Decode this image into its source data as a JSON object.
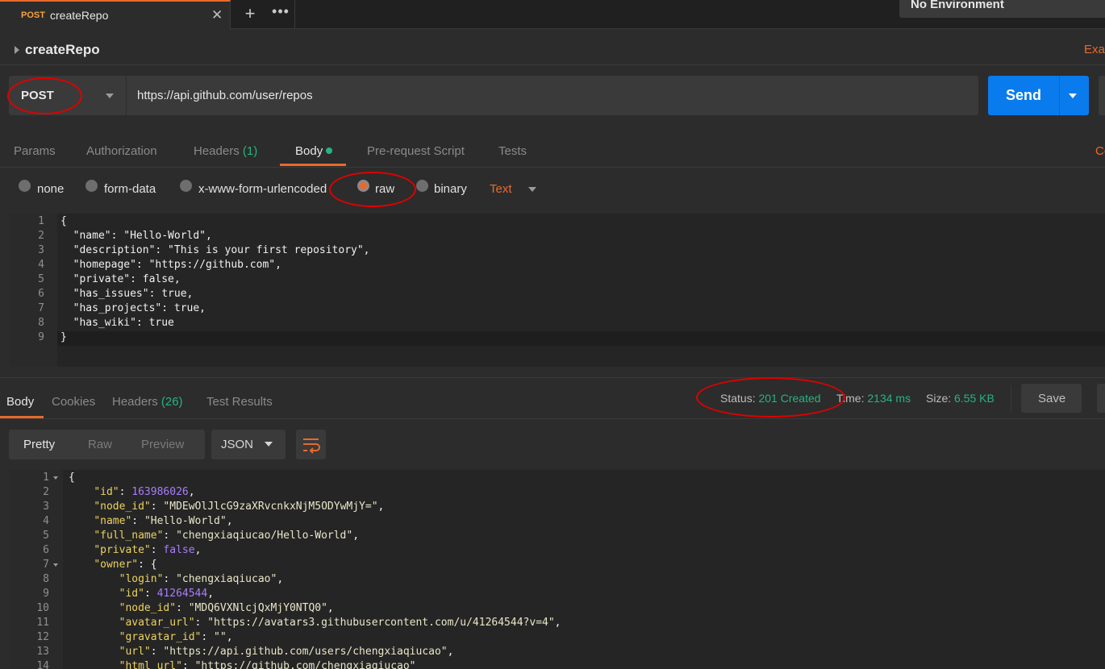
{
  "tabbar": {
    "active_tab": {
      "method": "POST",
      "name": "createRepo",
      "close": "✕"
    },
    "add_label": "+",
    "more_label": "•••",
    "environment": "No Environment"
  },
  "request": {
    "name": "createRepo",
    "examples_label": "Exa",
    "method": "POST",
    "url": "https://api.github.com/user/repos",
    "send_label": "Send"
  },
  "request_tabs": {
    "params": "Params",
    "authorization": "Authorization",
    "headers": "Headers",
    "headers_count": "(1)",
    "body": "Body",
    "prerequest": "Pre-request Script",
    "tests": "Tests",
    "cookies_right": "Co"
  },
  "body_types": {
    "none": "none",
    "form_data": "form-data",
    "urlencoded": "x-www-form-urlencoded",
    "raw": "raw",
    "binary": "binary",
    "text_type": "Text"
  },
  "request_body": {
    "line_numbers": [
      "1",
      "2",
      "3",
      "4",
      "5",
      "6",
      "7",
      "8",
      "9"
    ],
    "lines": [
      "{",
      "  \"name\": \"Hello-World\",",
      "  \"description\": \"This is your first repository\",",
      "  \"homepage\": \"https://github.com\",",
      "  \"private\": false,",
      "  \"has_issues\": true,",
      "  \"has_projects\": true,",
      "  \"has_wiki\": true",
      "}"
    ]
  },
  "response": {
    "tabs": {
      "body": "Body",
      "cookies": "Cookies",
      "headers": "Headers",
      "headers_count": "(26)",
      "test_results": "Test Results"
    },
    "status_label": "Status:",
    "status_value": "201 Created",
    "time_label": "Time:",
    "time_value": "2134 ms",
    "size_label": "Size:",
    "size_value": "6.55 KB",
    "save_label": "Save",
    "view_modes": {
      "pretty": "Pretty",
      "raw": "Raw",
      "preview": "Preview"
    },
    "format": "JSON",
    "line_numbers": [
      "1",
      "2",
      "3",
      "4",
      "5",
      "6",
      "7",
      "8",
      "9",
      "10",
      "11",
      "12",
      "13",
      "14"
    ],
    "lines": [
      [
        [
          "jp",
          "{"
        ]
      ],
      [
        [
          "jp",
          "    "
        ],
        [
          "jk",
          "\"id\""
        ],
        [
          "jp",
          ": "
        ],
        [
          "jn",
          "163986026"
        ],
        [
          "jp",
          ","
        ]
      ],
      [
        [
          "jp",
          "    "
        ],
        [
          "jk",
          "\"node_id\""
        ],
        [
          "jp",
          ": "
        ],
        [
          "js",
          "\"MDEwOlJlcG9zaXRvcnkxNjM5ODYwMjY=\""
        ],
        [
          "jp",
          ","
        ]
      ],
      [
        [
          "jp",
          "    "
        ],
        [
          "jk",
          "\"name\""
        ],
        [
          "jp",
          ": "
        ],
        [
          "js",
          "\"Hello-World\""
        ],
        [
          "jp",
          ","
        ]
      ],
      [
        [
          "jp",
          "    "
        ],
        [
          "jk",
          "\"full_name\""
        ],
        [
          "jp",
          ": "
        ],
        [
          "js",
          "\"chengxiaqiucao/Hello-World\""
        ],
        [
          "jp",
          ","
        ]
      ],
      [
        [
          "jp",
          "    "
        ],
        [
          "jk",
          "\"private\""
        ],
        [
          "jp",
          ": "
        ],
        [
          "jb",
          "false"
        ],
        [
          "jp",
          ","
        ]
      ],
      [
        [
          "jp",
          "    "
        ],
        [
          "jk",
          "\"owner\""
        ],
        [
          "jp",
          ": {"
        ]
      ],
      [
        [
          "jp",
          "        "
        ],
        [
          "jk",
          "\"login\""
        ],
        [
          "jp",
          ": "
        ],
        [
          "js",
          "\"chengxiaqiucao\""
        ],
        [
          "jp",
          ","
        ]
      ],
      [
        [
          "jp",
          "        "
        ],
        [
          "jk",
          "\"id\""
        ],
        [
          "jp",
          ": "
        ],
        [
          "jn",
          "41264544"
        ],
        [
          "jp",
          ","
        ]
      ],
      [
        [
          "jp",
          "        "
        ],
        [
          "jk",
          "\"node_id\""
        ],
        [
          "jp",
          ": "
        ],
        [
          "js",
          "\"MDQ6VXNlcjQxMjY0NTQ0\""
        ],
        [
          "jp",
          ","
        ]
      ],
      [
        [
          "jp",
          "        "
        ],
        [
          "jk",
          "\"avatar_url\""
        ],
        [
          "jp",
          ": "
        ],
        [
          "js",
          "\"https://avatars3.githubusercontent.com/u/41264544?v=4\""
        ],
        [
          "jp",
          ","
        ]
      ],
      [
        [
          "jp",
          "        "
        ],
        [
          "jk",
          "\"gravatar_id\""
        ],
        [
          "jp",
          ": "
        ],
        [
          "js",
          "\"\""
        ],
        [
          "jp",
          ","
        ]
      ],
      [
        [
          "jp",
          "        "
        ],
        [
          "jk",
          "\"url\""
        ],
        [
          "jp",
          ": "
        ],
        [
          "js",
          "\"https://api.github.com/users/chengxiaqiucao\""
        ],
        [
          "jp",
          ","
        ]
      ],
      [
        [
          "jp",
          "        "
        ],
        [
          "jk",
          "\"html_url\""
        ],
        [
          "jp",
          ": "
        ],
        [
          "js",
          "\"https://github.com/chengxiaqiucao\""
        ]
      ]
    ]
  },
  "colors": {
    "accent": "#e8692d",
    "send": "#097bed",
    "success": "#26b47f",
    "annotation": "#e00000"
  }
}
